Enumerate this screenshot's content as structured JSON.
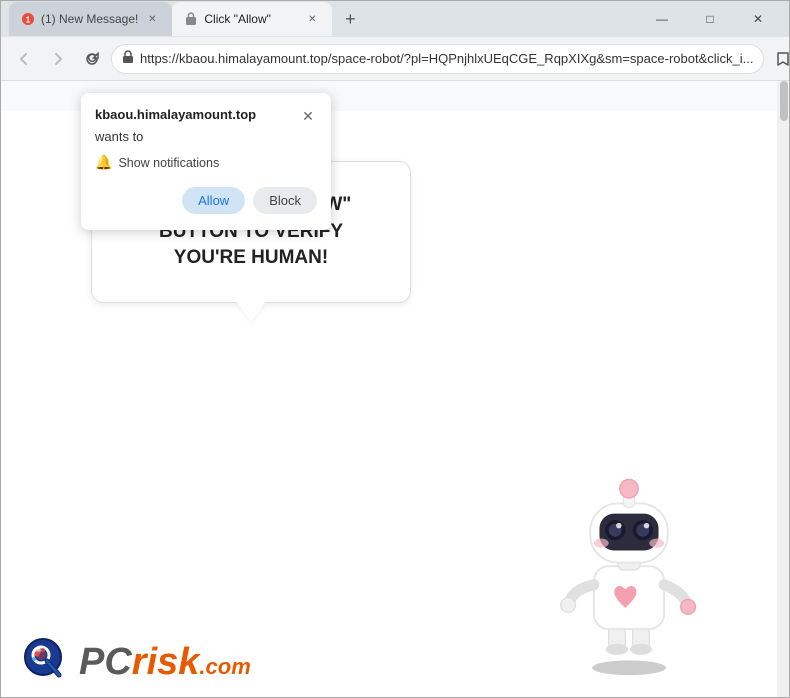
{
  "window": {
    "title_inactive_tab": "(1) New Message!",
    "title_active_tab": "Click \"Allow\"",
    "controls": {
      "minimize": "—",
      "maximize": "□",
      "close": "✕"
    }
  },
  "toolbar": {
    "back": "←",
    "forward": "→",
    "refresh": "↻",
    "url": "https://kbaou.himalayamount.top/space-robot/?pl=HQPnjhlxUEqCGE_RqpXIXg&sm=space-robot&click_i...",
    "url_display": "https://kbaou.himalayamount.top/space-robot/?pl=HQPnjhlxUEqCGE_RqpXIXg&sm=space-robot&click_i..."
  },
  "notification": {
    "site": "kbaou.himalayamount.top",
    "wants_label": "wants to",
    "permission_label": "Show notifications",
    "allow_label": "Allow",
    "block_label": "Block"
  },
  "page": {
    "message_line1": "PRESS THE \"ALLOW\" BUTTON TO VERIFY",
    "message_line2": "YOU'RE HUMAN!"
  },
  "logo": {
    "pc": "PC",
    "risk": "risk",
    "dotcom": ".com"
  }
}
